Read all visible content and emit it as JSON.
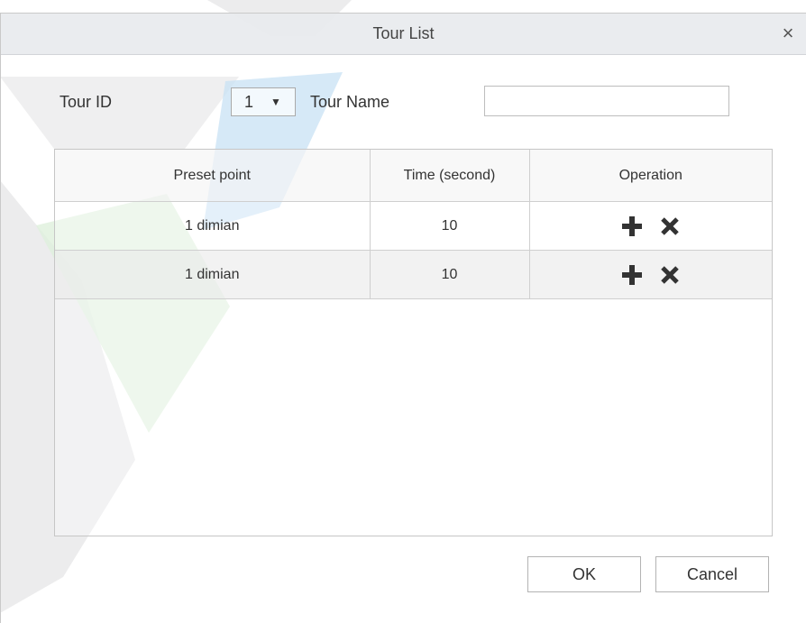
{
  "dialog": {
    "title": "Tour List",
    "close_glyph": "×"
  },
  "form": {
    "tour_id_label": "Tour ID",
    "tour_id_value": "1",
    "tour_id_caret": "▼",
    "tour_name_label": "Tour Name",
    "tour_name_value": ""
  },
  "table": {
    "headers": [
      "Preset point",
      "Time (second)",
      "Operation"
    ],
    "rows": [
      {
        "preset": "1  dimian",
        "time": "10"
      },
      {
        "preset": "1  dimian",
        "time": "10"
      }
    ],
    "operation_icons": [
      "plus-icon",
      "close-icon"
    ]
  },
  "footer": {
    "ok_label": "OK",
    "cancel_label": "Cancel"
  },
  "colors": {
    "titlebar": "#e8eaee",
    "border": "#c6c6c6",
    "alt_row": "#eaeaea",
    "icon": "#333333"
  }
}
